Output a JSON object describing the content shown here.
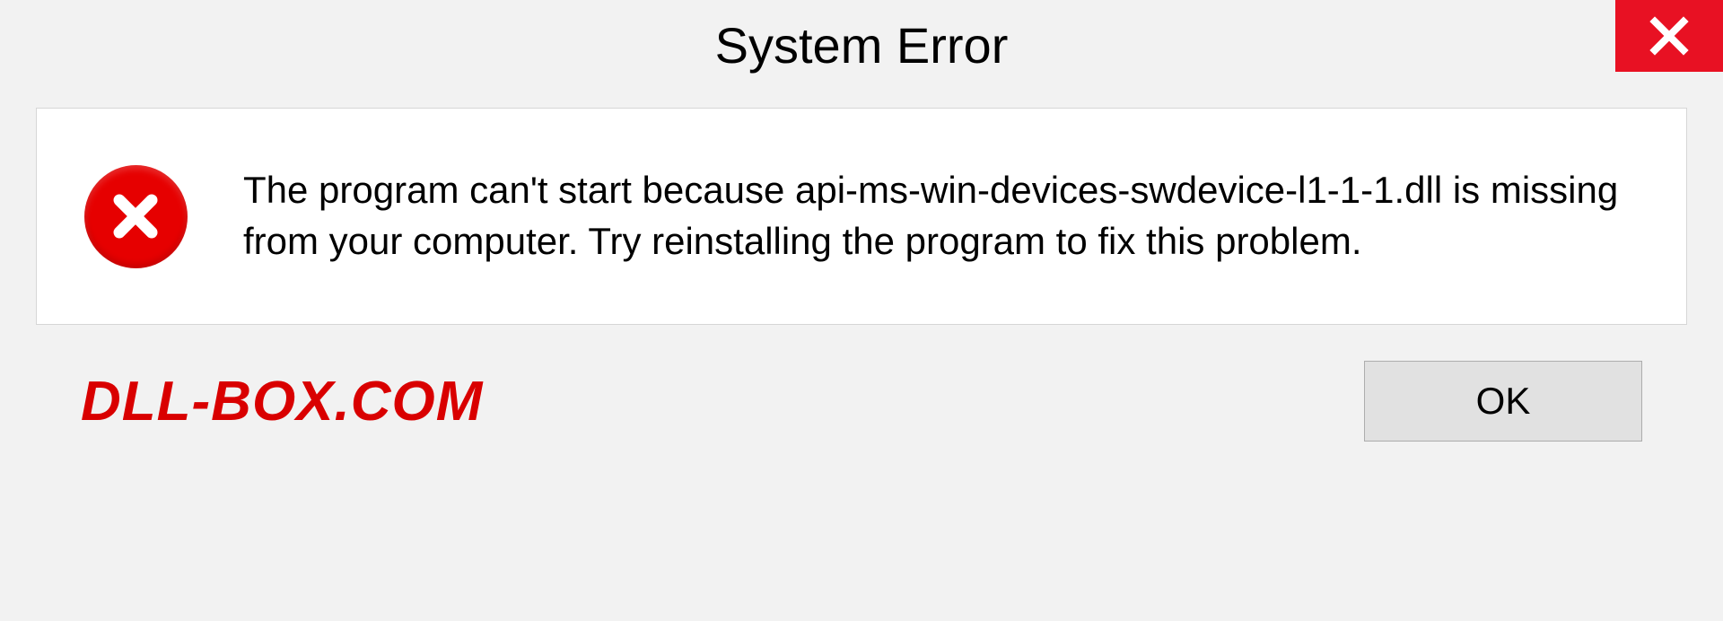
{
  "titlebar": {
    "title": "System Error"
  },
  "dialog": {
    "message": "The program can't start because api-ms-win-devices-swdevice-l1-1-1.dll is missing from your computer. Try reinstalling the program to fix this problem."
  },
  "footer": {
    "watermark": "DLL-BOX.COM",
    "ok_label": "OK"
  },
  "icons": {
    "close": "close-icon",
    "error": "error-icon"
  },
  "colors": {
    "close_bg": "#e81123",
    "error_bg": "#e60000",
    "watermark": "#d90000"
  }
}
